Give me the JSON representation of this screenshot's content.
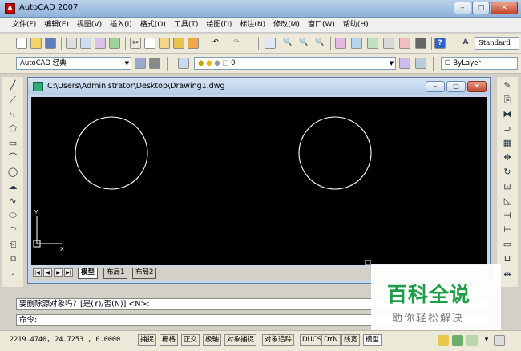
{
  "app": {
    "title": "AutoCAD 2007",
    "icon": "autocad-logo-icon"
  },
  "window_controls": {
    "minimize": "–",
    "maximize": "□",
    "close": "✕"
  },
  "menubar": {
    "items": [
      "文件(F)",
      "编辑(E)",
      "视图(V)",
      "插入(I)",
      "格式(O)",
      "工具(T)",
      "绘图(D)",
      "标注(N)",
      "修改(M)",
      "窗口(W)",
      "帮助(H)"
    ]
  },
  "toolbar1": {
    "text_style": "Standard"
  },
  "toolbar2": {
    "workspace": "AutoCAD 经典",
    "layer": "0",
    "color": "ByLayer"
  },
  "document": {
    "title": "C:\\Users\\Administrator\\Desktop\\Drawing1.dwg"
  },
  "ucs": {
    "y": "Y",
    "x": "X"
  },
  "layout_tabs": [
    "模型",
    "布局1",
    "布局2"
  ],
  "command": {
    "history": "要删除源对象吗？[是(Y)/否(N)] <N>:",
    "prompt": "命令:"
  },
  "status": {
    "coords": "2219.4740, 24.7253 , 0.0000",
    "buttons": [
      "捕捉",
      "栅格",
      "正交",
      "极轴",
      "对象捕捉",
      "对象追踪",
      "DUCS",
      "DYN",
      "线宽",
      "模型"
    ]
  },
  "watermark": {
    "title": "百科全说",
    "subtitle": "助你轻松解决"
  },
  "colors": {
    "canvas": "#000000",
    "geometry": "#ffffff",
    "watermark_green": "#1f9e4a"
  }
}
